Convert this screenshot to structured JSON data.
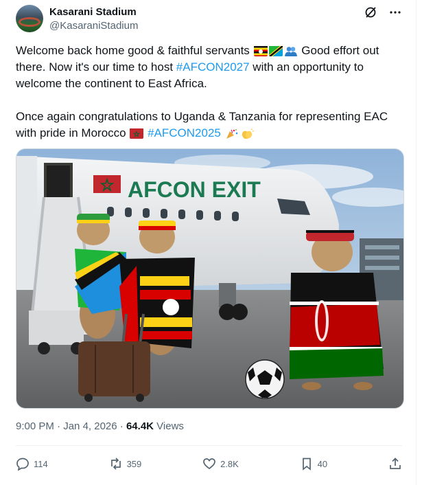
{
  "author": {
    "name": "Kasarani Stadium",
    "handle": "@KasaraniStadium",
    "avatar_icon": "stadium-avatar-icon"
  },
  "header_icons": [
    "grok-icon",
    "more-options-icon"
  ],
  "post": {
    "para1_part1": "Welcome back home good & faithful servants",
    "para1_emojis": [
      "uganda-flag",
      "tanzania-flag",
      "people-hugging-emoji"
    ],
    "para1_part2": " Good effort out there. Now it's our time to host ",
    "hashtag1": "#AFCON2027",
    "para1_part3": " with an opportunity to welcome the continent to East Africa.",
    "para2_part1": "Once again congratulations to Uganda & Tanzania for representing EAC with pride in Morocco ",
    "para2_flag": "morocco-flag",
    "hashtag2": "#AFCON2025",
    "para2_emojis": [
      "party-popper-emoji",
      "clapping-hands-emoji"
    ]
  },
  "media": {
    "plane_text": "AFCON EXIT",
    "plane_flag": "morocco-flag",
    "alt_description_icon": "meerkats-by-plane-image"
  },
  "meta": {
    "time": "9:00 PM",
    "separator1": " · ",
    "date": "Jan 4, 2026",
    "separator2": " · ",
    "views_count": "64.4K",
    "views_label": " Views"
  },
  "actions": {
    "replies": "114",
    "reposts": "359",
    "likes": "2.8K",
    "bookmarks": "40"
  },
  "colors": {
    "link": "#1d9bf0",
    "secondary_text": "#536471",
    "primary_text": "#0f1419",
    "plane_text": "#1b7a52"
  }
}
